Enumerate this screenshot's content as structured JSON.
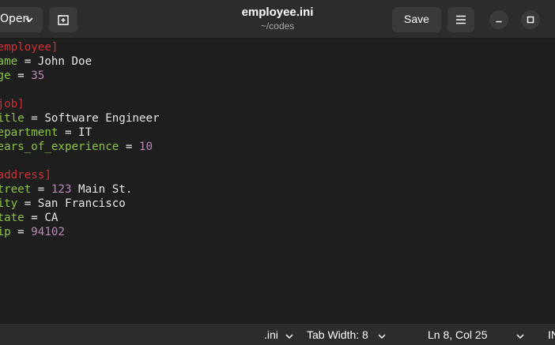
{
  "header": {
    "open_label": "Open",
    "title": "employee.ini",
    "subtitle": "~/codes",
    "save_label": "Save"
  },
  "editor": {
    "lines": [
      [
        {
          "t": "sec",
          "v": "[employee]"
        }
      ],
      [
        {
          "t": "key",
          "v": "name"
        },
        {
          "t": "eq",
          "v": " = "
        },
        {
          "t": "str",
          "v": "John Doe"
        }
      ],
      [
        {
          "t": "key",
          "v": "age"
        },
        {
          "t": "eq",
          "v": " = "
        },
        {
          "t": "num",
          "v": "35"
        }
      ],
      [],
      [
        {
          "t": "sec",
          "v": "[job]"
        }
      ],
      [
        {
          "t": "key",
          "v": "title"
        },
        {
          "t": "eq",
          "v": " = "
        },
        {
          "t": "str",
          "v": "Software Engineer"
        }
      ],
      [
        {
          "t": "key",
          "v": "department"
        },
        {
          "t": "eq",
          "v": " = "
        },
        {
          "t": "str",
          "v": "IT"
        }
      ],
      [
        {
          "t": "key",
          "v": "years_of_experience"
        },
        {
          "t": "eq",
          "v": " = "
        },
        {
          "t": "num",
          "v": "10"
        }
      ],
      [],
      [
        {
          "t": "sec",
          "v": "[address]"
        }
      ],
      [
        {
          "t": "key",
          "v": "street"
        },
        {
          "t": "eq",
          "v": " = "
        },
        {
          "t": "num",
          "v": "123"
        },
        {
          "t": "str",
          "v": " Main St."
        }
      ],
      [
        {
          "t": "key",
          "v": "city"
        },
        {
          "t": "eq",
          "v": " = "
        },
        {
          "t": "str",
          "v": "San Francisco"
        }
      ],
      [
        {
          "t": "key",
          "v": "state"
        },
        {
          "t": "eq",
          "v": " = "
        },
        {
          "t": "str",
          "v": "CA"
        }
      ],
      [
        {
          "t": "key",
          "v": "zip"
        },
        {
          "t": "eq",
          "v": " = "
        },
        {
          "t": "num",
          "v": "94102"
        }
      ]
    ]
  },
  "statusbar": {
    "language": ".ini",
    "tab_width": "Tab Width: 8",
    "cursor": "Ln 8, Col 25",
    "insert_mode": "INS"
  },
  "colors": {
    "section": "#d22e34",
    "key": "#8dc23c",
    "number": "#b987b6",
    "text": "#e8e8e8",
    "background": "#1e1e1e",
    "header": "#2c2c2c"
  },
  "icons": [
    "chevron-down-icon",
    "new-tab-icon",
    "hamburger-menu-icon",
    "minimize-icon",
    "maximize-icon"
  ]
}
